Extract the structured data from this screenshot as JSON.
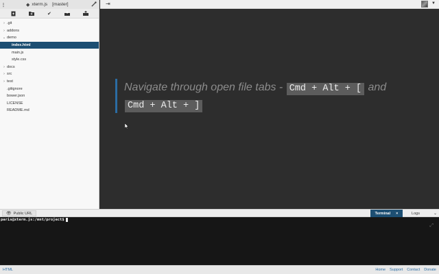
{
  "sidebar": {
    "project_name": "xterm.js",
    "branch": "[master]",
    "toolbar": [
      {
        "icon": "new-file-icon"
      },
      {
        "icon": "new-folder-icon"
      },
      {
        "icon": "checkmark-icon"
      },
      {
        "icon": "download-icon"
      },
      {
        "icon": "upload-icon"
      }
    ],
    "tree": [
      {
        "label": ".git",
        "type": "folder",
        "state": "collapsed"
      },
      {
        "label": "addons",
        "type": "folder",
        "state": "collapsed"
      },
      {
        "label": "demo",
        "type": "folder",
        "state": "expanded"
      },
      {
        "label": "index.html",
        "type": "file",
        "child": true,
        "selected": true
      },
      {
        "label": "main.js",
        "type": "file",
        "child": true
      },
      {
        "label": "style.css",
        "type": "file",
        "child": true
      },
      {
        "label": "docs",
        "type": "folder",
        "state": "collapsed"
      },
      {
        "label": "src",
        "type": "folder",
        "state": "collapsed"
      },
      {
        "label": "test",
        "type": "folder",
        "state": "collapsed"
      },
      {
        "label": ".gitignore",
        "type": "file"
      },
      {
        "label": "bower.json",
        "type": "file"
      },
      {
        "label": "LICENSE",
        "type": "file"
      },
      {
        "label": "README.md",
        "type": "file"
      }
    ]
  },
  "editor": {
    "hint_text": "Navigate through open file tabs -",
    "shortcut_1": "Cmd + Alt + [",
    "hint_join": "and",
    "shortcut_2": "Cmd + Alt + ]"
  },
  "bottom_bar": {
    "public_url_label": "Public URL",
    "terminal_tab": "Terminal",
    "terminal_close": "×",
    "logs_tab": "Logs"
  },
  "terminal": {
    "prompt": "paris@xterm.js:/mnt/project$"
  },
  "status_bar": {
    "mode": "HTML",
    "links": [
      "Home",
      "Support",
      "Contact",
      "Donate"
    ]
  },
  "colors": {
    "accent": "#1d4f73",
    "hint_border": "#2b6ca3",
    "editor_bg": "#2d2d2d",
    "terminal_bg": "#161616"
  }
}
